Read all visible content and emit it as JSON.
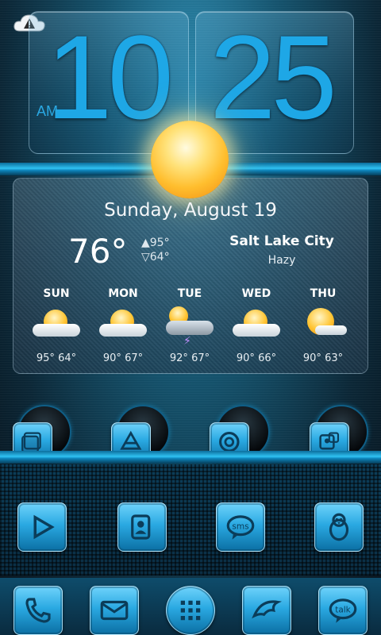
{
  "clock": {
    "hours": "10",
    "minutes": "25",
    "ampm": "AM"
  },
  "weather": {
    "date": "Sunday, August 19",
    "current_temp": "76°",
    "high": "▲95°",
    "low": "▽64°",
    "city": "Salt Lake City",
    "condition": "Hazy",
    "forecast": [
      {
        "day": "SUN",
        "temps": "95° 64°",
        "icon": "partly-cloudy"
      },
      {
        "day": "MON",
        "temps": "90° 67°",
        "icon": "partly-cloudy"
      },
      {
        "day": "TUE",
        "temps": "92° 67°",
        "icon": "thunderstorm"
      },
      {
        "day": "WED",
        "temps": "90° 66°",
        "icon": "partly-cloudy"
      },
      {
        "day": "THU",
        "temps": "90° 63°",
        "icon": "mostly-sunny"
      }
    ]
  },
  "status": {
    "alert_icon": "cloud-alert-icon"
  },
  "homescreen": {
    "folders": [
      {
        "name": "folder-1",
        "icon": "folder-stack-icon"
      },
      {
        "name": "folder-2",
        "icon": "drive-icon"
      },
      {
        "name": "folder-3",
        "icon": "browser-icon"
      },
      {
        "name": "folder-4",
        "icon": "contacts-folder-icon"
      }
    ],
    "apps": [
      {
        "name": "play-store",
        "icon": "play-icon"
      },
      {
        "name": "contacts",
        "icon": "contacts-icon"
      },
      {
        "name": "messaging",
        "icon": "sms-icon"
      },
      {
        "name": "penguin-app",
        "icon": "penguin-icon"
      }
    ],
    "dock": [
      {
        "name": "phone",
        "icon": "phone-icon"
      },
      {
        "name": "email",
        "icon": "mail-icon"
      },
      {
        "name": "app-drawer",
        "icon": "grid-icon"
      },
      {
        "name": "browser",
        "icon": "dolphin-icon"
      },
      {
        "name": "talk",
        "icon": "talk-icon",
        "label": "talk"
      }
    ]
  },
  "colors": {
    "accent": "#1ea7e6",
    "background": "#0a2636"
  }
}
